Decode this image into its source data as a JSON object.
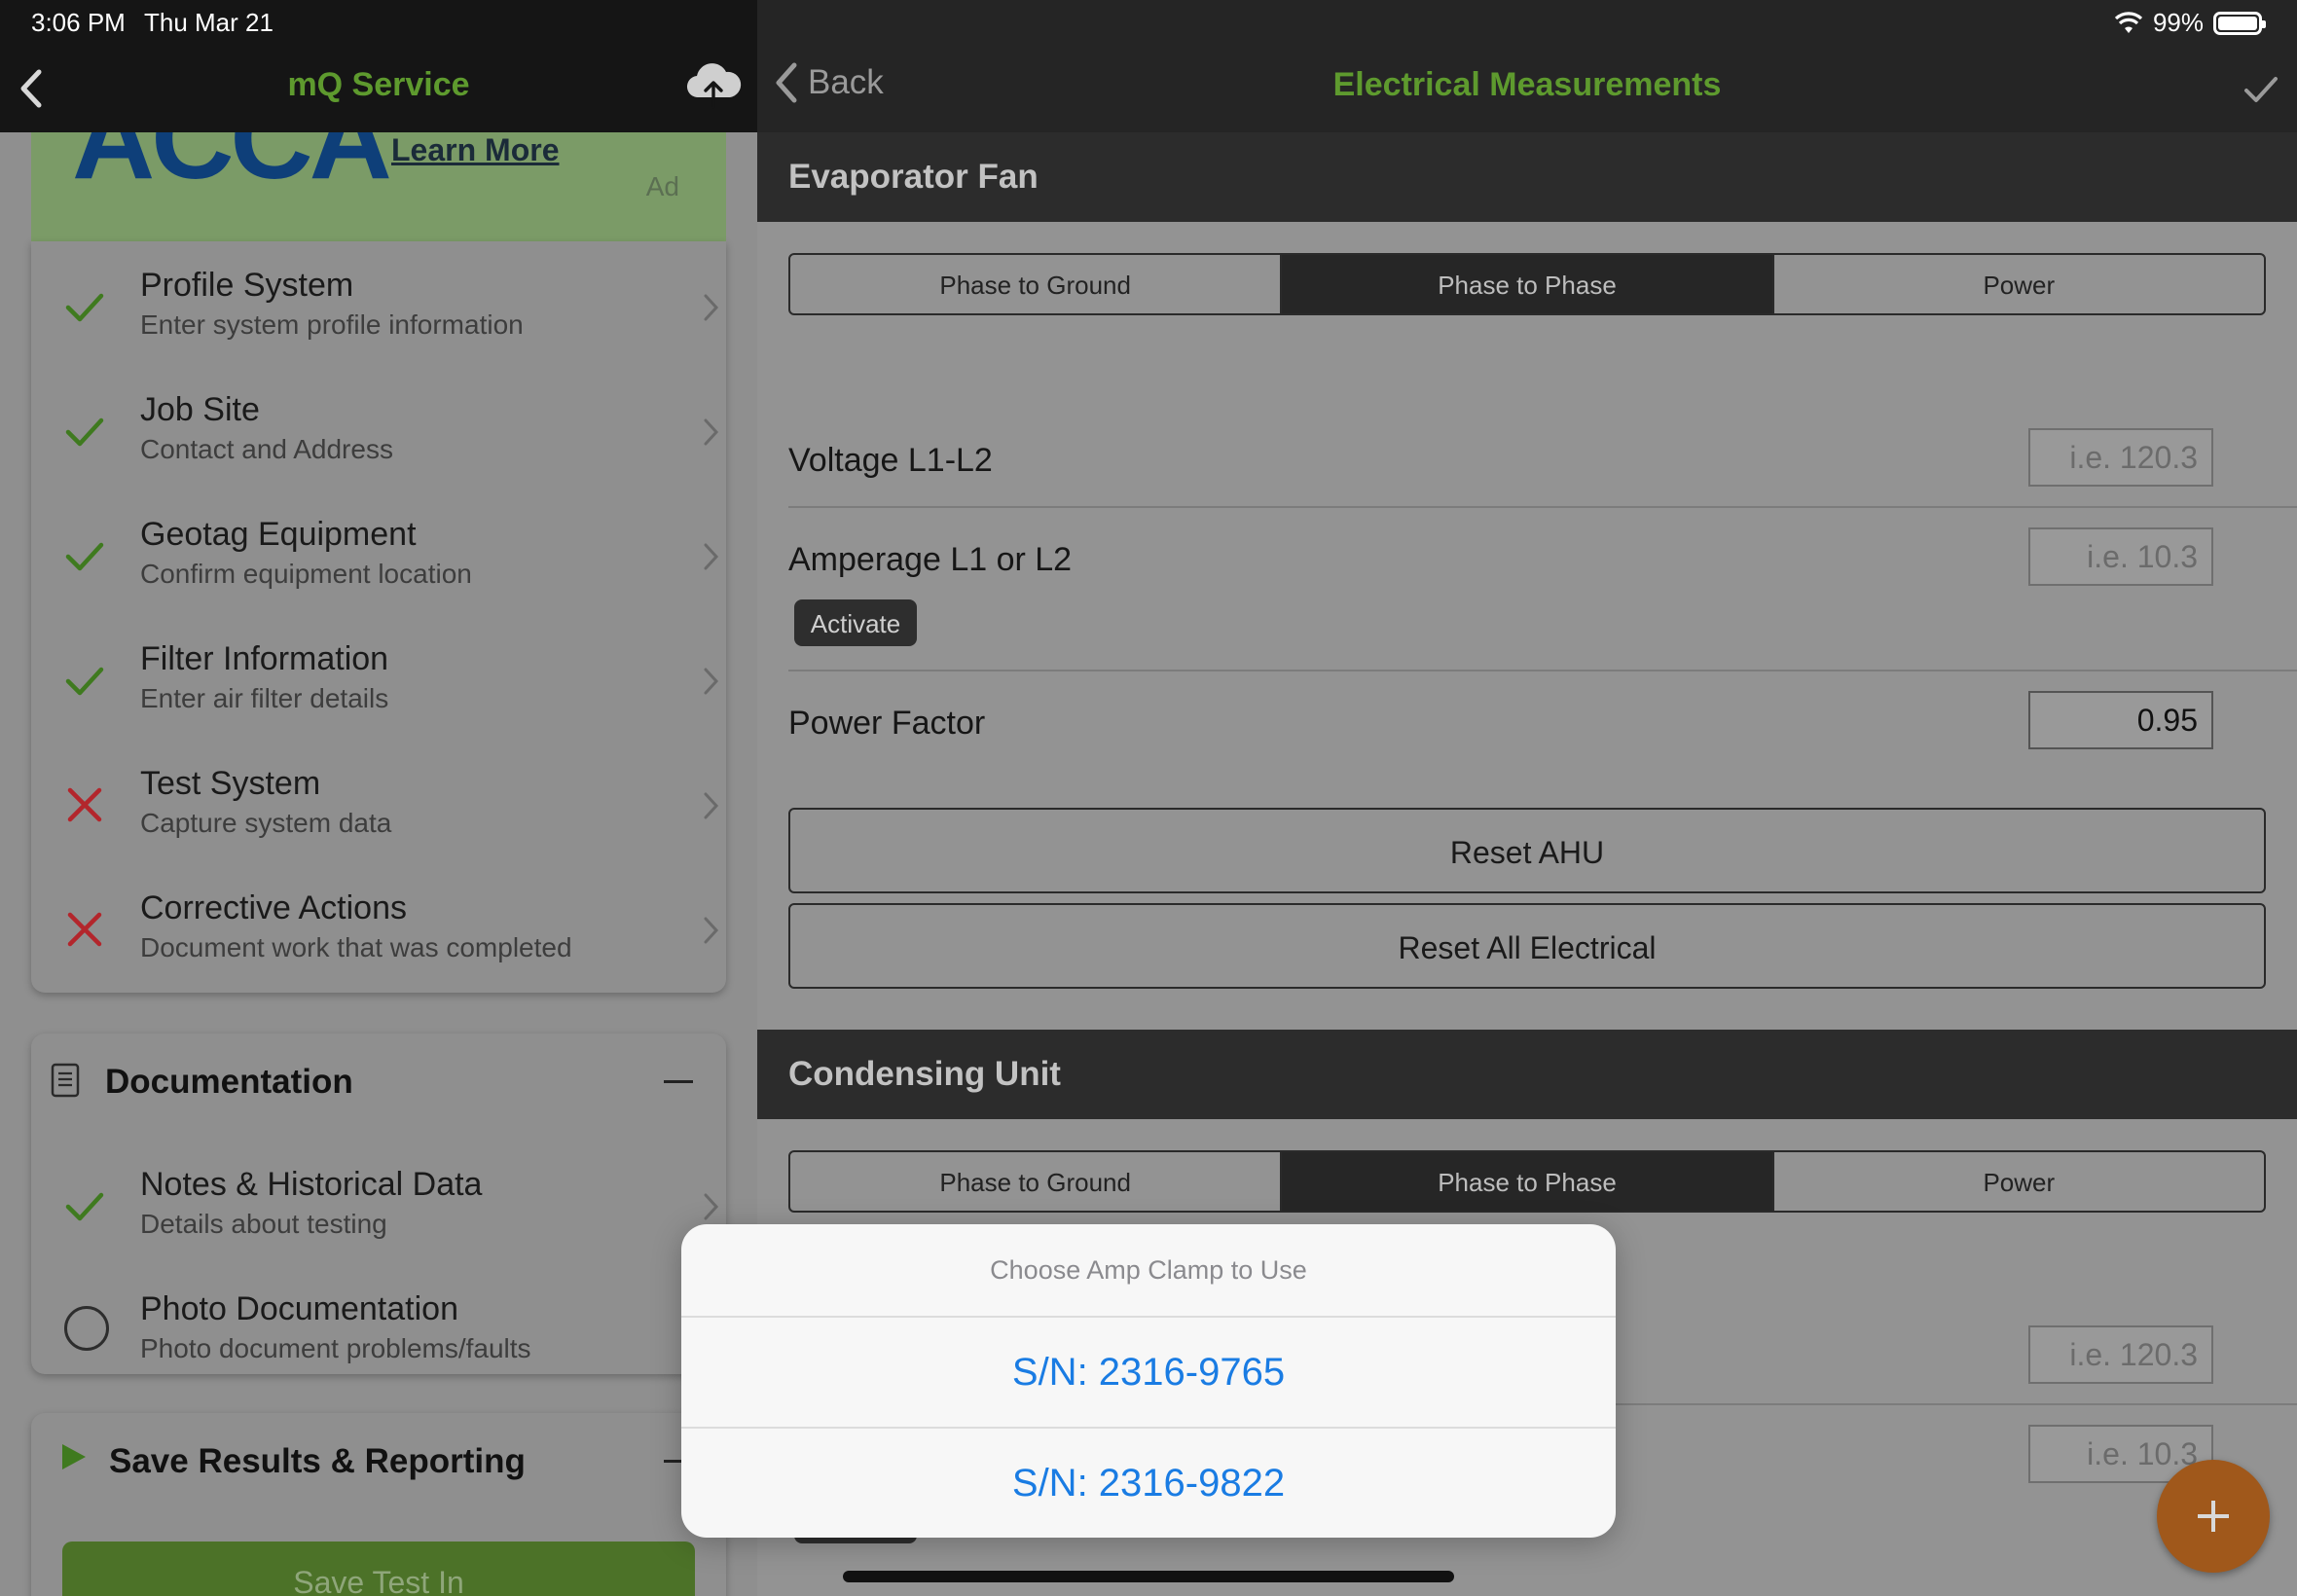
{
  "status_bar": {
    "time": "3:06 PM",
    "date": "Thu Mar 21",
    "battery": "99%"
  },
  "left": {
    "nav_title": "mQ Service",
    "ad": {
      "logo": "ACCA",
      "link": "Learn More",
      "tag": "Ad"
    },
    "steps": [
      {
        "title": "Profile System",
        "subtitle": "Enter system profile information",
        "status": "done"
      },
      {
        "title": "Job Site",
        "subtitle": "Contact and Address",
        "status": "done"
      },
      {
        "title": "Geotag Equipment",
        "subtitle": "Confirm equipment location",
        "status": "done"
      },
      {
        "title": "Filter Information",
        "subtitle": "Enter air filter details",
        "status": "done"
      },
      {
        "title": "Test System",
        "subtitle": "Capture system data",
        "status": "failed"
      },
      {
        "title": "Corrective Actions",
        "subtitle": "Document work that was completed",
        "status": "failed"
      }
    ],
    "documentation": {
      "title": "Documentation",
      "items": [
        {
          "title": "Notes & Historical Data",
          "subtitle": "Details about testing",
          "status": "done"
        },
        {
          "title": "Photo Documentation",
          "subtitle": "Photo document problems/faults",
          "status": "empty"
        }
      ]
    },
    "save_section": {
      "title": "Save Results & Reporting",
      "button": "Save Test In"
    }
  },
  "right": {
    "back_label": "Back",
    "title": "Electrical Measurements",
    "evaporator": {
      "title": "Evaporator Fan",
      "segments": [
        "Phase to Ground",
        "Phase to Phase",
        "Power"
      ],
      "selected": "Phase to Phase",
      "voltage_label": "Voltage L1-L2",
      "voltage_placeholder": "i.e. 120.3",
      "amperage_label": "Amperage L1 or L2",
      "amperage_placeholder": "i.e. 10.3",
      "activate": "Activate",
      "power_factor_label": "Power Factor",
      "power_factor_value": "0.95",
      "reset_ahu": "Reset AHU",
      "reset_all": "Reset All Electrical"
    },
    "condensing": {
      "title": "Condensing Unit",
      "segments": [
        "Phase to Ground",
        "Phase to Phase",
        "Power"
      ],
      "selected": "Phase to Phase",
      "voltage_placeholder": "i.e. 120.3",
      "amperage_placeholder": "i.e. 10.3"
    }
  },
  "action_sheet": {
    "title": "Choose Amp Clamp to Use",
    "options": [
      "S/N: 2316-9765",
      "S/N: 2316-9822"
    ]
  },
  "colors": {
    "accent_green": "#5e9a2e",
    "check_green": "#3f7a1f",
    "fail_red": "#b3262c",
    "link_blue": "#1a7ce3",
    "fab_orange": "#a0581b"
  }
}
